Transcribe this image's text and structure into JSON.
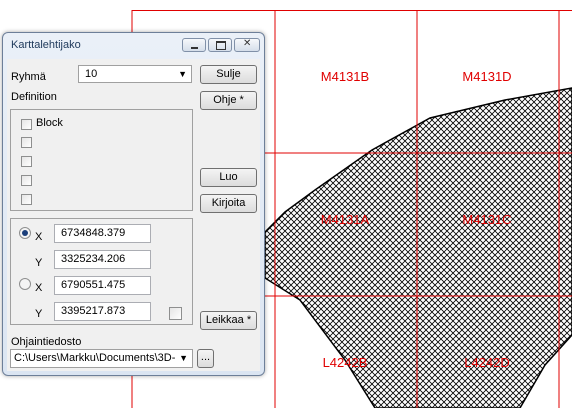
{
  "dialog": {
    "title": "Karttalehtijako",
    "group_label": "Ryhmä",
    "group_value": "10",
    "definition_label": "Definition",
    "block_label": "Block",
    "coord1": {
      "x_label": "X",
      "x_value": "6734848.379",
      "y_label": "Y",
      "y_value": "3325234.206",
      "selected": true
    },
    "coord2": {
      "x_label": "X",
      "x_value": "6790551.475",
      "y_label": "Y",
      "y_value": "3395217.873",
      "selected": false
    },
    "buttons": {
      "sulje": "Sulje",
      "ohje": "Ohje *",
      "luo": "Luo",
      "kirjoita": "Kirjoita",
      "leikkaa": "Leikkaa *",
      "browse": "..."
    },
    "control_file_label": "Ohjaintiedosto",
    "control_file_value": "C:\\Users\\Markku\\Documents\\3D-"
  },
  "map": {
    "sheets": [
      "M4131B",
      "M4131D",
      "M4131A",
      "M4131C",
      "L4242B",
      "L4242D"
    ],
    "grid_color": "#e00000",
    "label_color": "#e00000"
  }
}
